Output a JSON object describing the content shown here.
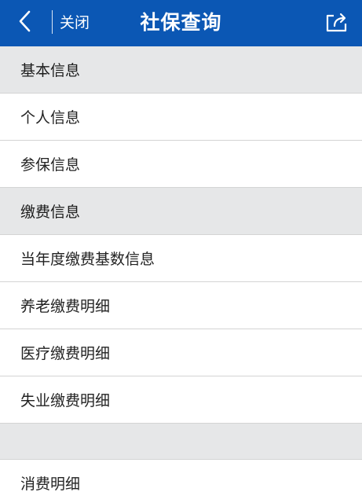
{
  "header": {
    "close_label": "关闭",
    "title": "社保查询",
    "back_icon": "chevron-left-icon",
    "share_icon": "share-icon",
    "background_color": "#0b57b4"
  },
  "sections": [
    {
      "heading": "基本信息",
      "items": [
        "个人信息",
        "参保信息"
      ]
    },
    {
      "heading": "缴费信息",
      "items": [
        "当年度缴费基数信息",
        "养老缴费明细",
        "医疗缴费明细",
        "失业缴费明细"
      ]
    },
    {
      "heading": "",
      "items": [
        "消费明细"
      ]
    }
  ]
}
